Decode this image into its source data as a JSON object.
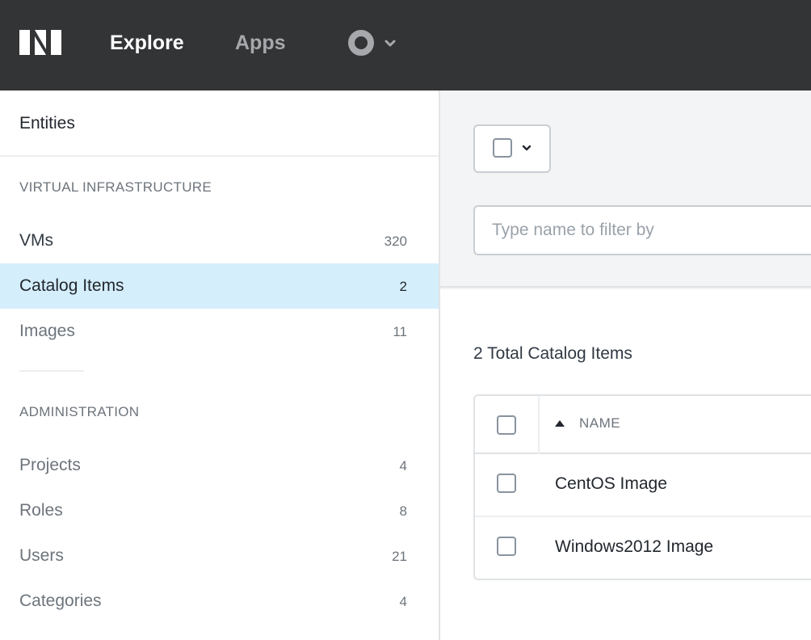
{
  "topbar": {
    "nav": [
      {
        "label": "Explore"
      },
      {
        "label": "Apps"
      }
    ],
    "user_menu_icon": "user-circle-icon"
  },
  "sidebar": {
    "title": "Entities",
    "sections": [
      {
        "title": "VIRTUAL INFRASTRUCTURE",
        "items": [
          {
            "label": "VMs",
            "count": "320"
          },
          {
            "label": "Catalog Items",
            "count": "2",
            "active": true
          },
          {
            "label": "Images",
            "count": "11"
          }
        ]
      },
      {
        "title": "ADMINISTRATION",
        "items": [
          {
            "label": "Projects",
            "count": "4"
          },
          {
            "label": "Roles",
            "count": "8"
          },
          {
            "label": "Users",
            "count": "21"
          },
          {
            "label": "Categories",
            "count": "4"
          }
        ]
      }
    ]
  },
  "main": {
    "filter_placeholder": "Type name to filter by",
    "total_label": "2 Total Catalog Items",
    "table": {
      "columns": [
        {
          "label": "NAME",
          "sort": "ascending"
        }
      ],
      "rows": [
        {
          "name": "CentOS Image"
        },
        {
          "name": "Windows2012 Image"
        }
      ]
    }
  },
  "colors": {
    "topbar_bg": "#333436",
    "active_item_bg": "#d4eefb",
    "text_primary": "#22272e",
    "text_muted": "#6d747c"
  }
}
